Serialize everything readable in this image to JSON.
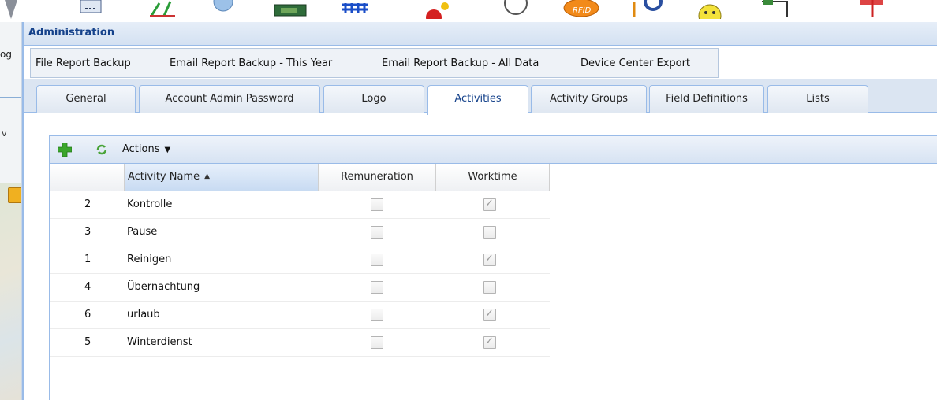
{
  "top_toolbar": {
    "icons": [
      "tower-icon",
      "calculator-icon",
      "chart-icon",
      "globe-icon",
      "map-icon",
      "fence-icon",
      "pie-chart-icon",
      "clock-icon",
      "rfid-icon",
      "search-icon",
      "smiley-icon",
      "document-icon",
      "flag-icon"
    ]
  },
  "background_app": {
    "partial_text": "og",
    "partial_label": "v"
  },
  "window": {
    "title": "Administration"
  },
  "menu": {
    "items": [
      "File Report Backup",
      "Email Report Backup - This Year",
      "Email Report Backup - All Data",
      "Device Center Export"
    ]
  },
  "tabs": [
    {
      "label": "General",
      "active": false
    },
    {
      "label": "Account Admin Password",
      "active": false
    },
    {
      "label": "Logo",
      "active": false
    },
    {
      "label": "Activities",
      "active": true
    },
    {
      "label": "Activity Groups",
      "active": false
    },
    {
      "label": "Field Definitions",
      "active": false
    },
    {
      "label": "Lists",
      "active": false
    }
  ],
  "toolbar": {
    "actions_label": "Actions",
    "add_icon": "add-icon",
    "refresh_icon": "refresh-icon"
  },
  "grid": {
    "columns": [
      "",
      "Activity Name",
      "Remuneration",
      "Worktime"
    ],
    "sort": {
      "column": "Activity Name",
      "direction": "asc"
    },
    "rows": [
      {
        "id": "2",
        "name": "Kontrolle",
        "remuneration": false,
        "worktime": true
      },
      {
        "id": "3",
        "name": "Pause",
        "remuneration": false,
        "worktime": false
      },
      {
        "id": "1",
        "name": "Reinigen",
        "remuneration": false,
        "worktime": true
      },
      {
        "id": "4",
        "name": "Übernachtung",
        "remuneration": false,
        "worktime": false
      },
      {
        "id": "6",
        "name": "urlaub",
        "remuneration": false,
        "worktime": true
      },
      {
        "id": "5",
        "name": "Winterdienst",
        "remuneration": false,
        "worktime": true
      }
    ]
  },
  "colors": {
    "accent": "#15428b",
    "border": "#99bbe8",
    "add": "#3aa52b",
    "refresh": "#4aa43a"
  }
}
